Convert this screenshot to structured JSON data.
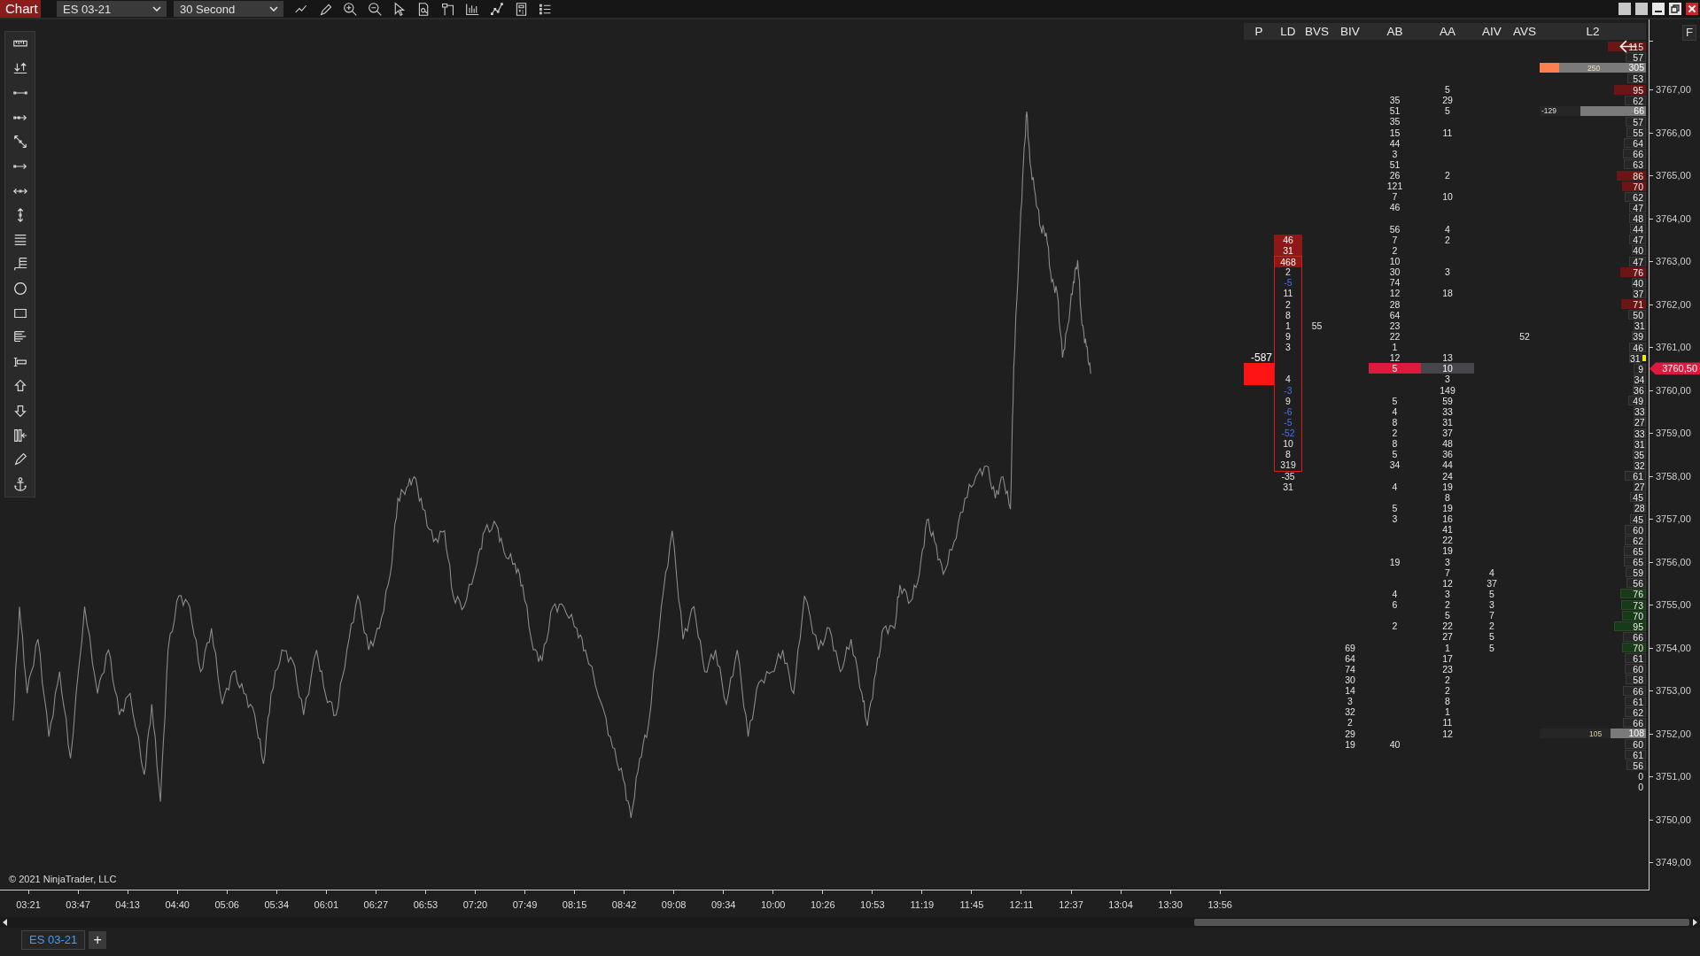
{
  "window": {
    "app_label": "Chart",
    "instrument": "ES 03-21",
    "interval": "30 Second"
  },
  "ladder": {
    "columns": [
      "P",
      "LD",
      "BVS",
      "BIV",
      "AB",
      "AA",
      "AIV",
      "AVS",
      "L2"
    ],
    "rows": [
      {
        "l2": {
          "value": "115",
          "kind": "ask"
        }
      },
      {
        "l2": {
          "value": "57",
          "kind": "plain"
        }
      },
      {
        "l2": {
          "value": "305",
          "kind": "order",
          "note": "250",
          "level": 1
        }
      },
      {
        "l2": {
          "value": "53",
          "kind": "plain"
        }
      },
      {
        "aa": "5",
        "l2": {
          "value": "95",
          "kind": "ask"
        }
      },
      {
        "ab": "35",
        "aa": "29",
        "l2": {
          "value": "62",
          "kind": "plain"
        }
      },
      {
        "ab": "51",
        "aa": "5",
        "l2": {
          "value": "66",
          "kind": "volume",
          "note": "-129",
          "level": 0.62
        }
      },
      {
        "ab": "35",
        "l2": {
          "value": "57",
          "kind": "plain"
        }
      },
      {
        "ab": "15",
        "aa": "11",
        "l2": {
          "value": "55",
          "kind": "plain"
        }
      },
      {
        "ab": "44",
        "l2": {
          "value": "64",
          "kind": "plain"
        }
      },
      {
        "ab": "3",
        "l2": {
          "value": "66",
          "kind": "plain"
        }
      },
      {
        "ab": "51",
        "l2": {
          "value": "63",
          "kind": "plain"
        }
      },
      {
        "ab": "26",
        "aa": "2",
        "l2": {
          "value": "86",
          "kind": "ask"
        }
      },
      {
        "ab": "121",
        "l2": {
          "value": "70",
          "kind": "ask"
        }
      },
      {
        "ab": "7",
        "aa": "10",
        "l2": {
          "value": "62",
          "kind": "plain"
        }
      },
      {
        "ab": "46",
        "l2": {
          "value": "47",
          "kind": "plain"
        }
      },
      {
        "l2": {
          "value": "48",
          "kind": "plain"
        }
      },
      {
        "ab": "56",
        "aa": "4",
        "l2": {
          "value": "44",
          "kind": "plain"
        }
      },
      {
        "ld": {
          "value": "46",
          "kind": "hot"
        },
        "ab": "7",
        "aa": "2",
        "l2": {
          "value": "47",
          "kind": "plain"
        }
      },
      {
        "ld": {
          "value": "31",
          "kind": "hot"
        },
        "ab": "2",
        "l2": {
          "value": "40",
          "kind": "plain"
        }
      },
      {
        "ld": {
          "value": "468",
          "kind": "hot"
        },
        "boxed": true,
        "ab": "10",
        "l2": {
          "value": "47",
          "kind": "plain"
        }
      },
      {
        "ld": {
          "value": "2",
          "kind": "plain"
        },
        "boxed": true,
        "ab": "30",
        "aa": "3",
        "l2": {
          "value": "76",
          "kind": "ask"
        }
      },
      {
        "ld": {
          "value": "-5",
          "kind": "neg"
        },
        "boxed": true,
        "ab": "74",
        "l2": {
          "value": "40",
          "kind": "plain"
        }
      },
      {
        "ld": {
          "value": "11",
          "kind": "plain"
        },
        "boxed": true,
        "ab": "12",
        "aa": "18",
        "l2": {
          "value": "37",
          "kind": "plain"
        }
      },
      {
        "ld": {
          "value": "2",
          "kind": "plain"
        },
        "boxed": true,
        "ab": "28",
        "l2": {
          "value": "71",
          "kind": "ask"
        }
      },
      {
        "ld": {
          "value": "8",
          "kind": "plain"
        },
        "boxed": true,
        "ab": "64",
        "l2": {
          "value": "50",
          "kind": "plain"
        }
      },
      {
        "ld": {
          "value": "1",
          "kind": "plain"
        },
        "boxed": true,
        "bvs": "55",
        "ab": "23",
        "l2": {
          "value": "31",
          "kind": "plain"
        }
      },
      {
        "ld": {
          "value": "9",
          "kind": "plain"
        },
        "boxed": true,
        "ab": "22",
        "avs": "52",
        "l2": {
          "value": "39",
          "kind": "plain"
        }
      },
      {
        "ld": {
          "value": "3",
          "kind": "plain"
        },
        "boxed": true,
        "ab": "1",
        "l2": {
          "value": "46",
          "kind": "plain"
        }
      },
      {
        "p": "-587",
        "boxed": true,
        "ab": "12",
        "aa": "13",
        "l2": {
          "value": "31",
          "kind": "plain"
        },
        "flag": true
      },
      {
        "p_block": true,
        "boxed": true,
        "current": true,
        "ab": "5",
        "aa": "10",
        "l2": {
          "value": "9",
          "kind": "plain"
        }
      },
      {
        "p_block": true,
        "ld": {
          "value": "4",
          "kind": "plain"
        },
        "boxed": true,
        "aa": "3",
        "l2": {
          "value": "34",
          "kind": "plain"
        }
      },
      {
        "ld": {
          "value": "-3",
          "kind": "neg"
        },
        "boxed": true,
        "aa": "149",
        "l2": {
          "value": "36",
          "kind": "plain"
        }
      },
      {
        "ld": {
          "value": "9",
          "kind": "plain"
        },
        "boxed": true,
        "ab": "5",
        "aa": "59",
        "l2": {
          "value": "49",
          "kind": "plain"
        }
      },
      {
        "ld": {
          "value": "-6",
          "kind": "neg"
        },
        "boxed": true,
        "ab": "4",
        "aa": "33",
        "l2": {
          "value": "33",
          "kind": "plain"
        }
      },
      {
        "ld": {
          "value": "-5",
          "kind": "neg"
        },
        "boxed": true,
        "ab": "8",
        "aa": "31",
        "l2": {
          "value": "27",
          "kind": "plain"
        }
      },
      {
        "ld": {
          "value": "-52",
          "kind": "neg"
        },
        "boxed": true,
        "ab": "2",
        "aa": "37",
        "l2": {
          "value": "33",
          "kind": "plain"
        }
      },
      {
        "ld": {
          "value": "10",
          "kind": "plain"
        },
        "boxed": true,
        "ab": "8",
        "aa": "48",
        "l2": {
          "value": "31",
          "kind": "plain"
        }
      },
      {
        "ld": {
          "value": "8",
          "kind": "plain"
        },
        "boxed": true,
        "ab": "5",
        "aa": "36",
        "l2": {
          "value": "35",
          "kind": "plain"
        }
      },
      {
        "ld": {
          "value": "319",
          "kind": "plain"
        },
        "boxed": true,
        "ab": "34",
        "aa": "44",
        "l2": {
          "value": "32",
          "kind": "plain"
        }
      },
      {
        "ld": {
          "value": "-35",
          "kind": "plain"
        },
        "aa": "24",
        "l2": {
          "value": "61",
          "kind": "plain"
        }
      },
      {
        "ld": {
          "value": "31",
          "kind": "plain"
        },
        "ab": "4",
        "aa": "19",
        "l2": {
          "value": "27",
          "kind": "plain"
        }
      },
      {
        "aa": "8",
        "l2": {
          "value": "45",
          "kind": "plain"
        }
      },
      {
        "ab": "5",
        "aa": "19",
        "l2": {
          "value": "28",
          "kind": "plain"
        }
      },
      {
        "ab": "3",
        "aa": "16",
        "l2": {
          "value": "45",
          "kind": "plain"
        }
      },
      {
        "aa": "41",
        "l2": {
          "value": "60",
          "kind": "plain"
        }
      },
      {
        "aa": "22",
        "l2": {
          "value": "62",
          "kind": "plain"
        }
      },
      {
        "aa": "19",
        "l2": {
          "value": "65",
          "kind": "plain"
        }
      },
      {
        "ab": "19",
        "aa": "3",
        "l2": {
          "value": "65",
          "kind": "plain"
        }
      },
      {
        "aa": "7",
        "aiv": "4",
        "l2": {
          "value": "59",
          "kind": "plain"
        }
      },
      {
        "aa": "12",
        "aiv": "37",
        "l2": {
          "value": "56",
          "kind": "plain"
        }
      },
      {
        "ab": "4",
        "aa": "3",
        "aiv": "5",
        "l2": {
          "value": "76",
          "kind": "bid"
        }
      },
      {
        "ab": "6",
        "aa": "2",
        "aiv": "3",
        "l2": {
          "value": "73",
          "kind": "bid"
        }
      },
      {
        "aa": "5",
        "aiv": "7",
        "l2": {
          "value": "70",
          "kind": "bid"
        }
      },
      {
        "ab": "2",
        "aa": "22",
        "aiv": "2",
        "l2": {
          "value": "95",
          "kind": "bid"
        }
      },
      {
        "aa": "27",
        "aiv": "5",
        "l2": {
          "value": "66",
          "kind": "plain"
        }
      },
      {
        "biv": "69",
        "aa": "1",
        "aiv": "5",
        "l2": {
          "value": "70",
          "kind": "bid"
        }
      },
      {
        "biv": "64",
        "aa": "17",
        "l2": {
          "value": "61",
          "kind": "plain"
        }
      },
      {
        "biv": "74",
        "aa": "23",
        "l2": {
          "value": "60",
          "kind": "plain"
        }
      },
      {
        "biv": "30",
        "aa": "2",
        "l2": {
          "value": "58",
          "kind": "plain"
        }
      },
      {
        "biv": "14",
        "aa": "2",
        "l2": {
          "value": "66",
          "kind": "plain"
        }
      },
      {
        "biv": "3",
        "aa": "8",
        "l2": {
          "value": "61",
          "kind": "plain"
        }
      },
      {
        "biv": "32",
        "aa": "1",
        "l2": {
          "value": "62",
          "kind": "plain"
        }
      },
      {
        "biv": "2",
        "aa": "11",
        "l2": {
          "value": "66",
          "kind": "plain"
        }
      },
      {
        "biv": "29",
        "aa": "12",
        "l2": {
          "value": "108",
          "kind": "volume",
          "note": "105",
          "level": 0.33
        }
      },
      {
        "biv": "19",
        "ab": "40",
        "l2": {
          "value": "60",
          "kind": "plain"
        }
      },
      {
        "l2": {
          "value": "61",
          "kind": "plain"
        }
      },
      {
        "l2": {
          "value": "56",
          "kind": "plain"
        }
      },
      {
        "l2": {
          "value": "0",
          "kind": "bare"
        }
      },
      {
        "l2": {
          "value": "0",
          "kind": "bare"
        }
      }
    ]
  },
  "price_axis": {
    "labels": [
      "3767,00",
      "3766,00",
      "3765,00",
      "3764,00",
      "3763,00",
      "3762,00",
      "3761,00",
      "3760,00",
      "3759,00",
      "3758,00",
      "3757,00",
      "3756,00",
      "3755,00",
      "3754,00",
      "3753,00",
      "3752,00",
      "3751,00",
      "3750,00",
      "3749,00"
    ],
    "last_price": "3760,50",
    "side_button": "F"
  },
  "time_axis": {
    "labels": [
      "03:21",
      "03:47",
      "04:13",
      "04:40",
      "05:06",
      "05:34",
      "06:01",
      "06:27",
      "06:53",
      "07:20",
      "07:49",
      "08:15",
      "08:42",
      "09:08",
      "09:34",
      "10:00",
      "10:26",
      "10:53",
      "11:19",
      "11:45",
      "12:11",
      "12:37",
      "13:04",
      "13:30",
      "13:56"
    ]
  },
  "copyright": "© 2021 NinjaTrader, LLC",
  "tabs": [
    {
      "label": "ES 03-21",
      "selected": true
    }
  ],
  "add_tab": "+"
}
